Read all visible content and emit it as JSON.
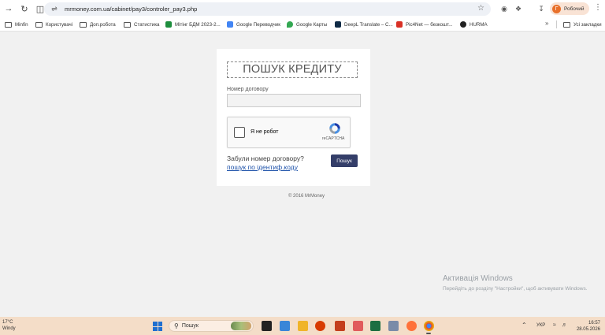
{
  "browser": {
    "url": "mrmoney.com.ua/cabinet/pay3/controler_pay3.php",
    "profile_initial": "Г",
    "profile_name": "Робочий",
    "bookmarks": [
      {
        "label": "Minfin",
        "icon": "folder-icon"
      },
      {
        "label": "Користувачі",
        "icon": "folder-icon"
      },
      {
        "label": "Доп.робота",
        "icon": "folder-icon"
      },
      {
        "label": "Статистика",
        "icon": "folder-icon"
      },
      {
        "label": "Мітінг БДМ 2023-2...",
        "icon": "sheets-icon"
      },
      {
        "label": "Google Переводчик",
        "icon": "translate-icon"
      },
      {
        "label": "Google Карты",
        "icon": "maps-icon"
      },
      {
        "label": "DeepL Translate – С...",
        "icon": "deepl-icon"
      },
      {
        "label": "Pic4Net — безкошт...",
        "icon": "pic4net-icon"
      },
      {
        "label": "HURMA",
        "icon": "hurma-icon"
      }
    ],
    "all_bookmarks_label": "Усі закладки"
  },
  "page": {
    "title": "ПОШУК КРЕДИТУ",
    "contract_label": "Номер договору",
    "contract_value": "",
    "recaptcha_label": "Я не робот",
    "recaptcha_brand": "reCAPTCHA",
    "forgot_text": "Забули номер договору?",
    "forgot_link": "пошук по ідентиф.коду",
    "search_button": "Пошук",
    "footer": "© 2016 MrMoney"
  },
  "watermark": {
    "title": "Активація Windows",
    "subtitle": "Перейдіть до розділу \"Настройки\", щоб активувати Windows."
  },
  "taskbar": {
    "temperature": "17°C",
    "weather": "Windy",
    "search_label": "Пошук",
    "language": "УКР",
    "time": "16:57",
    "date": "28.05.2026"
  },
  "colors": {
    "page_bg": "#f1f1f1",
    "button_bg": "#343e69",
    "link": "#1a4fa8",
    "taskbar_bg": "#f4ddc8"
  }
}
